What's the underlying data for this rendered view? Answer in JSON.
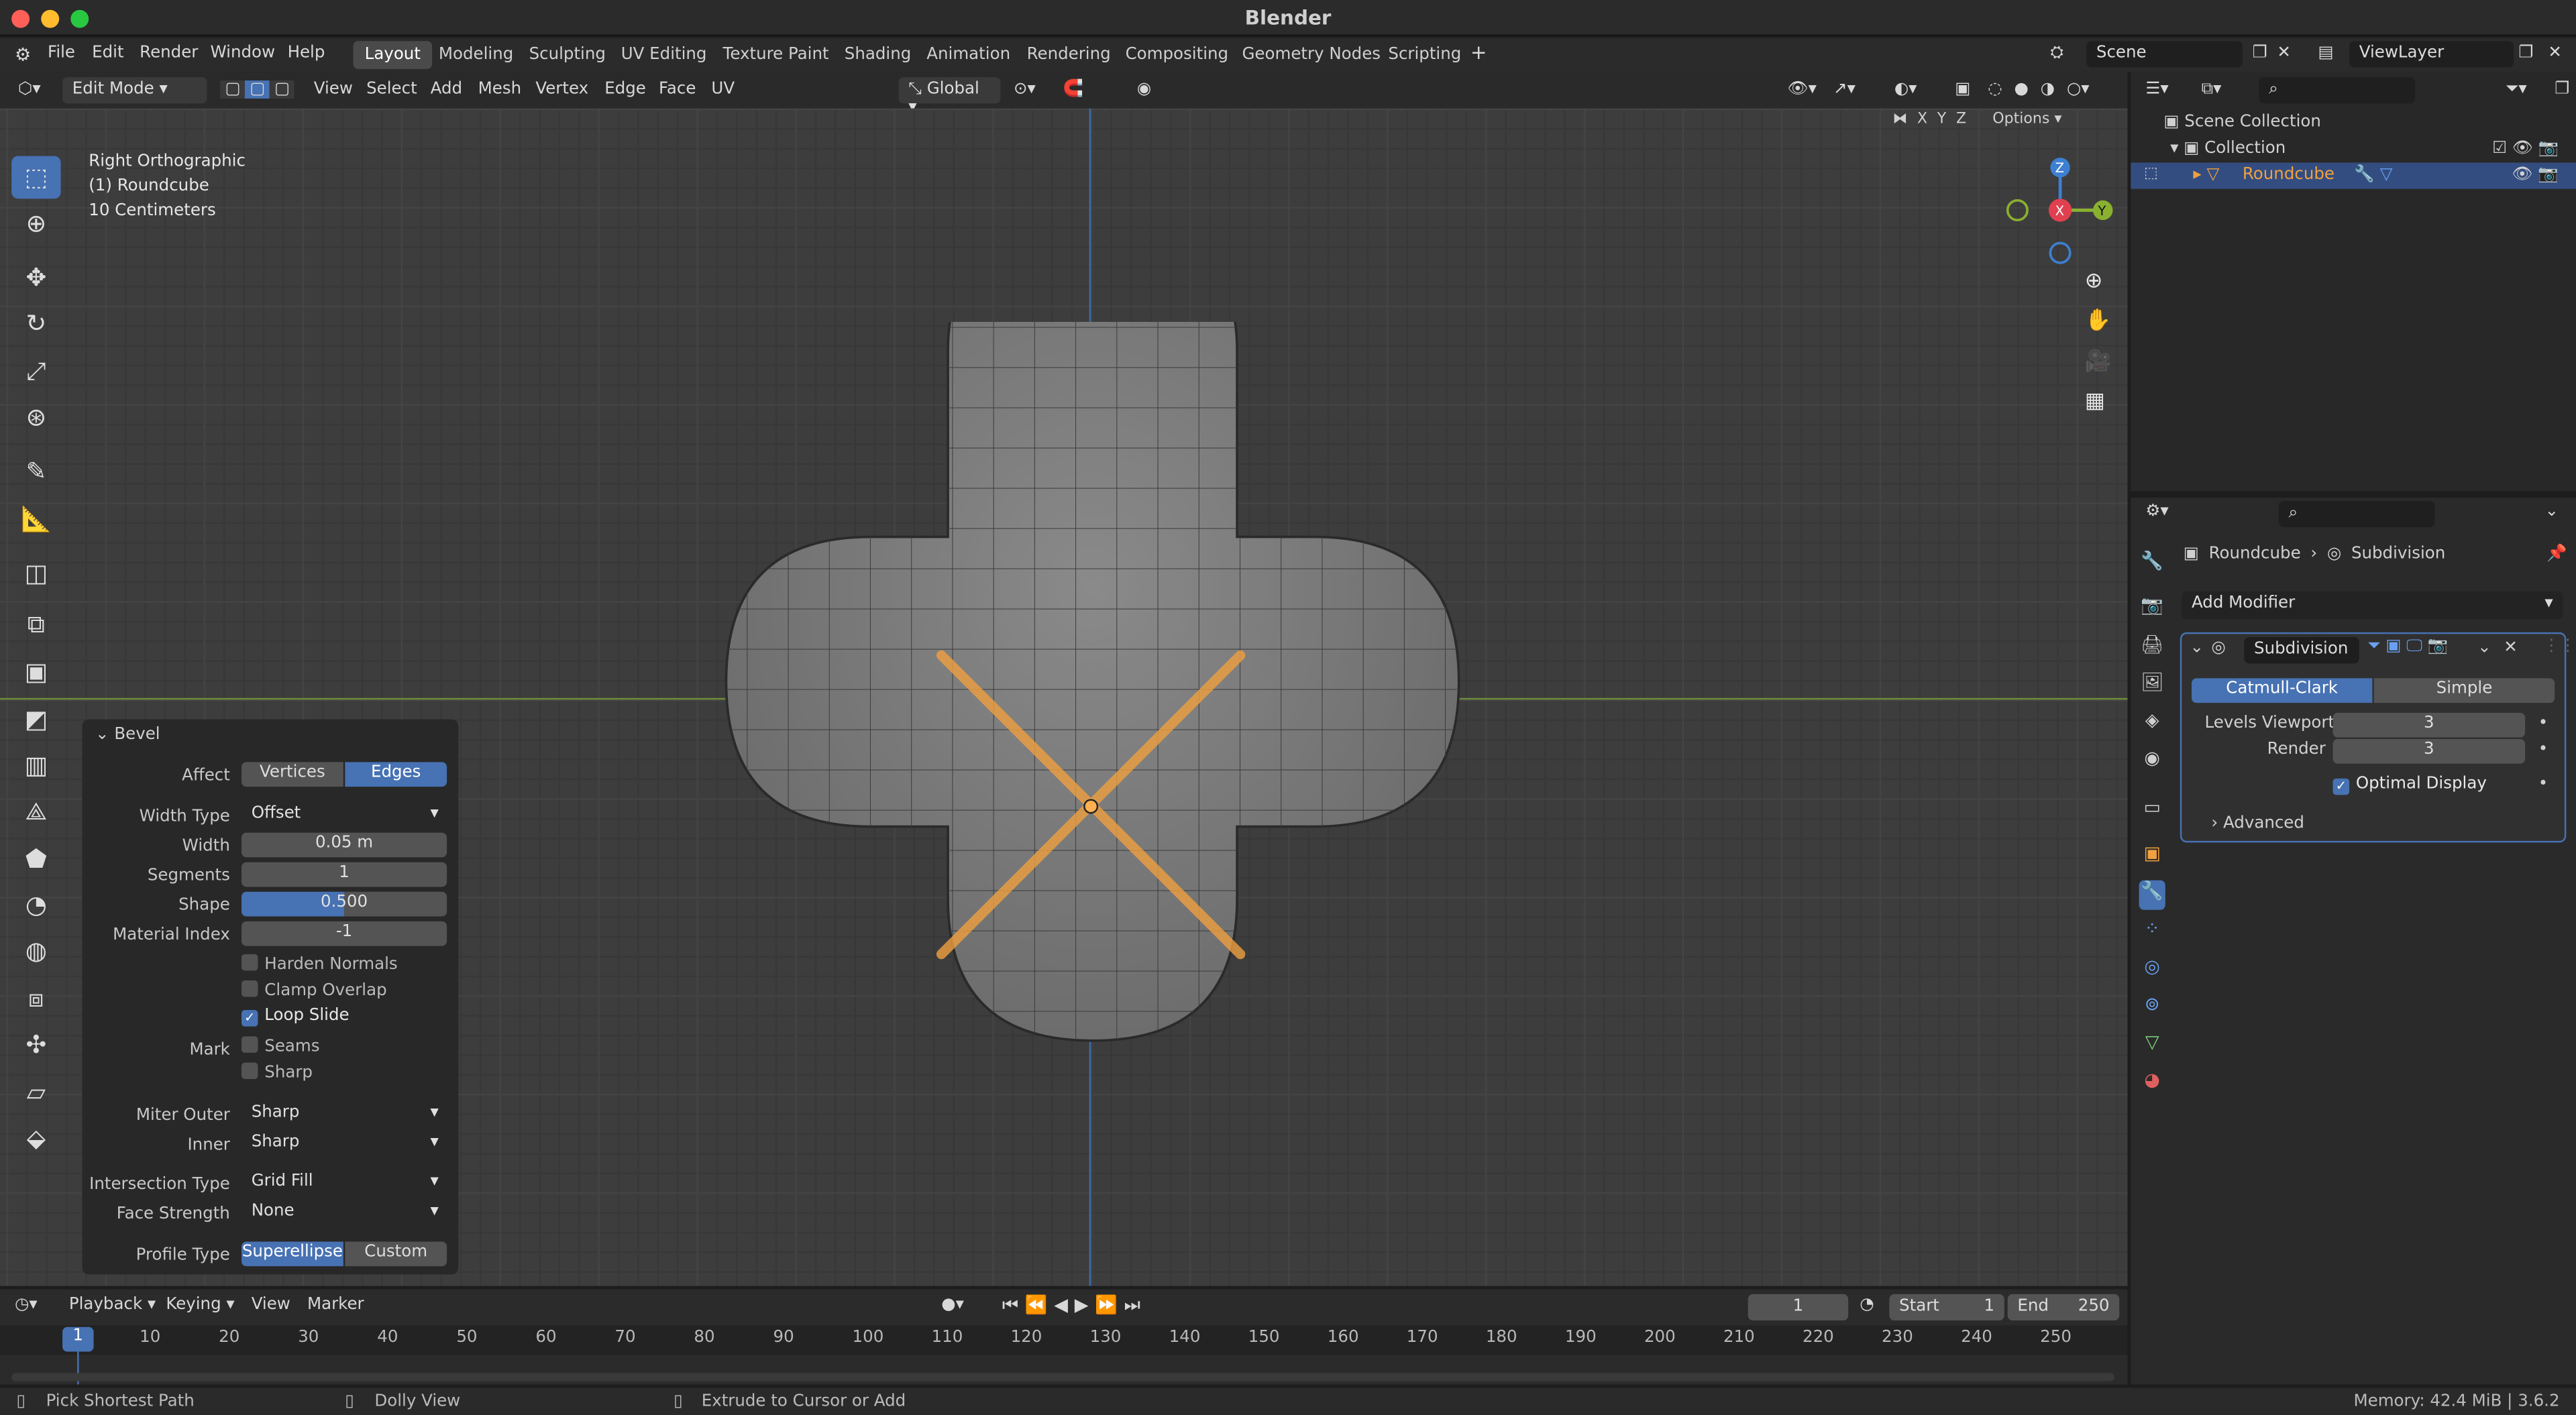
{
  "app": {
    "title": "Blender"
  },
  "topmenu": [
    "File",
    "Edit",
    "Render",
    "Window",
    "Help"
  ],
  "workspaces": [
    "Layout",
    "Modeling",
    "Sculpting",
    "UV Editing",
    "Texture Paint",
    "Shading",
    "Animation",
    "Rendering",
    "Compositing",
    "Geometry Nodes",
    "Scripting"
  ],
  "active_workspace": "Layout",
  "scene": "Scene",
  "viewlayer": "ViewLayer",
  "viewport_header": {
    "mode": "Edit Mode",
    "menus": [
      "View",
      "Select",
      "Add",
      "Mesh",
      "Vertex",
      "Edge",
      "Face",
      "UV"
    ],
    "orientation": "Global",
    "options": "Options",
    "axes": [
      "X",
      "Y",
      "Z"
    ]
  },
  "overlay": {
    "view": "Right Orthographic",
    "object": "(1) Roundcube",
    "scale": "10 Centimeters"
  },
  "gizmo": {
    "z": "Z",
    "x": "X",
    "y": "Y"
  },
  "bevel": {
    "title": "Bevel",
    "affect_label": "Affect",
    "affect_options": [
      "Vertices",
      "Edges"
    ],
    "affect_selected": "Edges",
    "width_type_label": "Width Type",
    "width_type": "Offset",
    "width_label": "Width",
    "width": "0.05 m",
    "segments_label": "Segments",
    "segments": "1",
    "shape_label": "Shape",
    "shape": "0.500",
    "shape_fraction": 0.5,
    "material_label": "Material Index",
    "material": "-1",
    "harden": "Harden Normals",
    "clamp": "Clamp Overlap",
    "loop": "Loop Slide",
    "mark_label": "Mark",
    "seams": "Seams",
    "sharp": "Sharp",
    "miter_outer_label": "Miter Outer",
    "miter_outer": "Sharp",
    "inner_label": "Inner",
    "inner": "Sharp",
    "intersection_label": "Intersection Type",
    "intersection": "Grid Fill",
    "face_strength_label": "Face Strength",
    "face_strength": "None",
    "profile_label": "Profile Type",
    "profile_options": [
      "Superellipse",
      "Custom"
    ],
    "profile_selected": "Superellipse"
  },
  "timeline": {
    "menus": [
      "Playback",
      "Keying",
      "View",
      "Marker"
    ],
    "current": "1",
    "start_label": "Start",
    "start": "1",
    "end_label": "End",
    "end": "250",
    "ticks": [
      "10",
      "20",
      "30",
      "40",
      "50",
      "60",
      "70",
      "80",
      "90",
      "100",
      "110",
      "120",
      "130",
      "140",
      "150",
      "160",
      "170",
      "180",
      "190",
      "200",
      "210",
      "220",
      "230",
      "240",
      "250"
    ],
    "frame_marker": "1"
  },
  "status": {
    "left": "Pick Shortest Path",
    "mid": "Dolly View",
    "right": "Extrude to Cursor or Add",
    "memory": "Memory: 42.4 MiB | 3.6.2"
  },
  "outliner": {
    "scene_collection": "Scene Collection",
    "collection": "Collection",
    "object": "Roundcube"
  },
  "properties": {
    "breadcrumb_obj": "Roundcube",
    "breadcrumb_mod": "Subdivision",
    "add_modifier": "Add Modifier",
    "modifier_name": "Subdivision",
    "catmull": "Catmull-Clark",
    "simple": "Simple",
    "levels_label": "Levels Viewport",
    "levels": "3",
    "render_label": "Render",
    "render": "3",
    "optimal": "Optimal Display",
    "advanced": "Advanced"
  },
  "colors": {
    "accent": "#4772b3",
    "selection": "#f0a040",
    "xaxis": "#e04050",
    "yaxis": "#8ab030",
    "zaxis": "#3d7fd0"
  }
}
